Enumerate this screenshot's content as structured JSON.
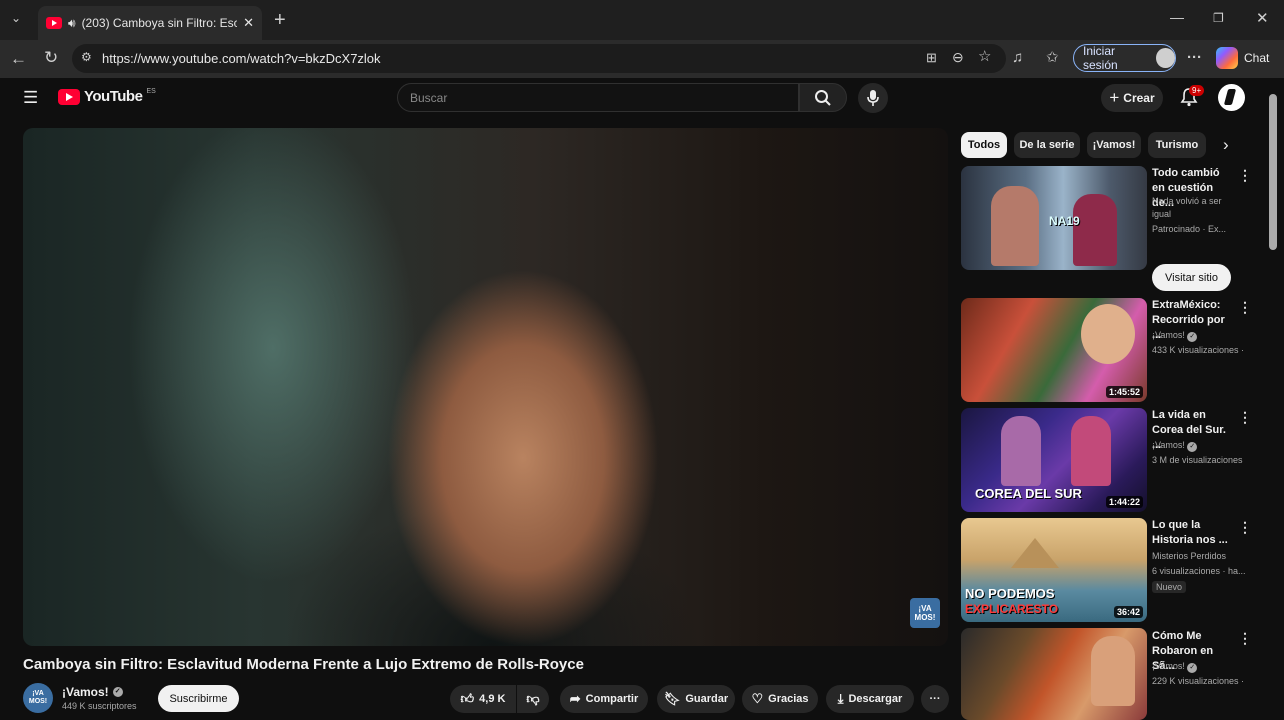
{
  "browser": {
    "tab_title": "(203) Camboya sin Filtro: Escla",
    "url": "https://www.youtube.com/watch?v=bkzDcX7zlok",
    "signin_label": "Iniciar sesión",
    "chat_label": "Chat"
  },
  "header": {
    "logo_text": "YouTube",
    "logo_region": "ES",
    "search_placeholder": "Buscar",
    "create_label": "Crear",
    "notifications_badge": "9+"
  },
  "video": {
    "title": "Camboya sin Filtro: Esclavitud Moderna Frente a Lujo Extremo de Rolls-Royce",
    "channel_name": "¡Vamos!",
    "channel_avatar_text": "¡VA MOS!",
    "subscribers": "449 K suscriptores",
    "subscribe_label": "Suscribirme",
    "likes": "4,9 K",
    "share_label": "Compartir",
    "save_label": "Guardar",
    "thanks_label": "Gracias",
    "download_label": "Descargar"
  },
  "chips": [
    "Todos",
    "De la serie",
    "¡Vamos!",
    "Turismo"
  ],
  "sponsored": {
    "title": "Todo cambió en cuestión de...",
    "desc": "Nada volvió a ser igual",
    "meta": "Patrocinado · Ex...",
    "cta": "Visitar sitio",
    "thumb_text": "NA19"
  },
  "related": [
    {
      "title": "ExtraMéxico: Recorrido por ...",
      "channel": "¡Vamos!",
      "meta": "433 K visualizaciones ·",
      "duration": "1:45:52",
      "extra": ""
    },
    {
      "title": "La vida en Corea del Sur. ...",
      "channel": "¡Vamos!",
      "meta": "3 M de visualizaciones",
      "duration": "1:44:22",
      "extra": "",
      "thumb_text": "COREA DEL SUR"
    },
    {
      "title": "Lo que la Historia nos ...",
      "channel": "Misterios Perdidos",
      "meta": "6 visualizaciones · ha...",
      "duration": "36:42",
      "extra": "Nuevo",
      "thumb_text": "NO PODEMOS",
      "thumb_text2": "EXPLICARESTO"
    },
    {
      "title": "Cómo Me Robaron en Sã...",
      "channel": "¡Vamos!",
      "meta": "229 K visualizaciones ·",
      "duration": "",
      "extra": ""
    }
  ],
  "icons": {
    "tab_list": "chevron-down-icon",
    "audio": "speaker-icon",
    "verified": "check-icon"
  }
}
